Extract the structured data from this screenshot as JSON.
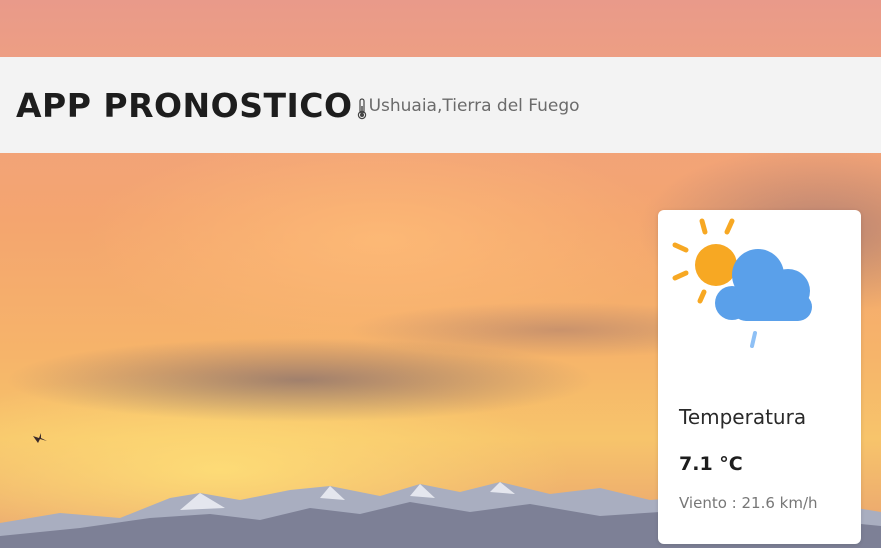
{
  "header": {
    "title": "APP PRONOSTICO",
    "location": "Ushuaia,Tierra del Fuego",
    "location_icon": "thermometer-icon"
  },
  "weather_card": {
    "icon": "partly-cloudy-rain-icon",
    "label": "Temperatura",
    "temperature": "7.1 °C",
    "wind": "Viento : 21.6 km/h"
  },
  "colors": {
    "header_bg": "#f3f3f3",
    "sun": "#f7a823",
    "cloud": "#5aa0ea",
    "rain": "#8ec0f5"
  }
}
